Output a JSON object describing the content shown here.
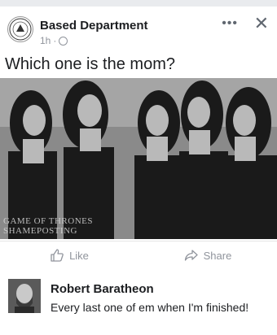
{
  "post": {
    "page_name": "Based Department",
    "time": "1h",
    "separator": "·",
    "caption": "Which one is the mom?",
    "watermark_line1": "GAME OF THRONES",
    "watermark_line2": "SHAMEPOSTING"
  },
  "actions": {
    "like_label": "Like",
    "share_label": "Share"
  },
  "comment": {
    "author": "Robert Baratheon",
    "text": "Every last one of em when I'm finished!"
  },
  "icons": {
    "more": "more-horizontal-icon",
    "close": "close-icon",
    "globe": "globe-icon",
    "like": "thumbs-up-icon",
    "share": "share-arrow-icon"
  },
  "colors": {
    "muted": "#90949c",
    "text": "#1c1e21"
  }
}
